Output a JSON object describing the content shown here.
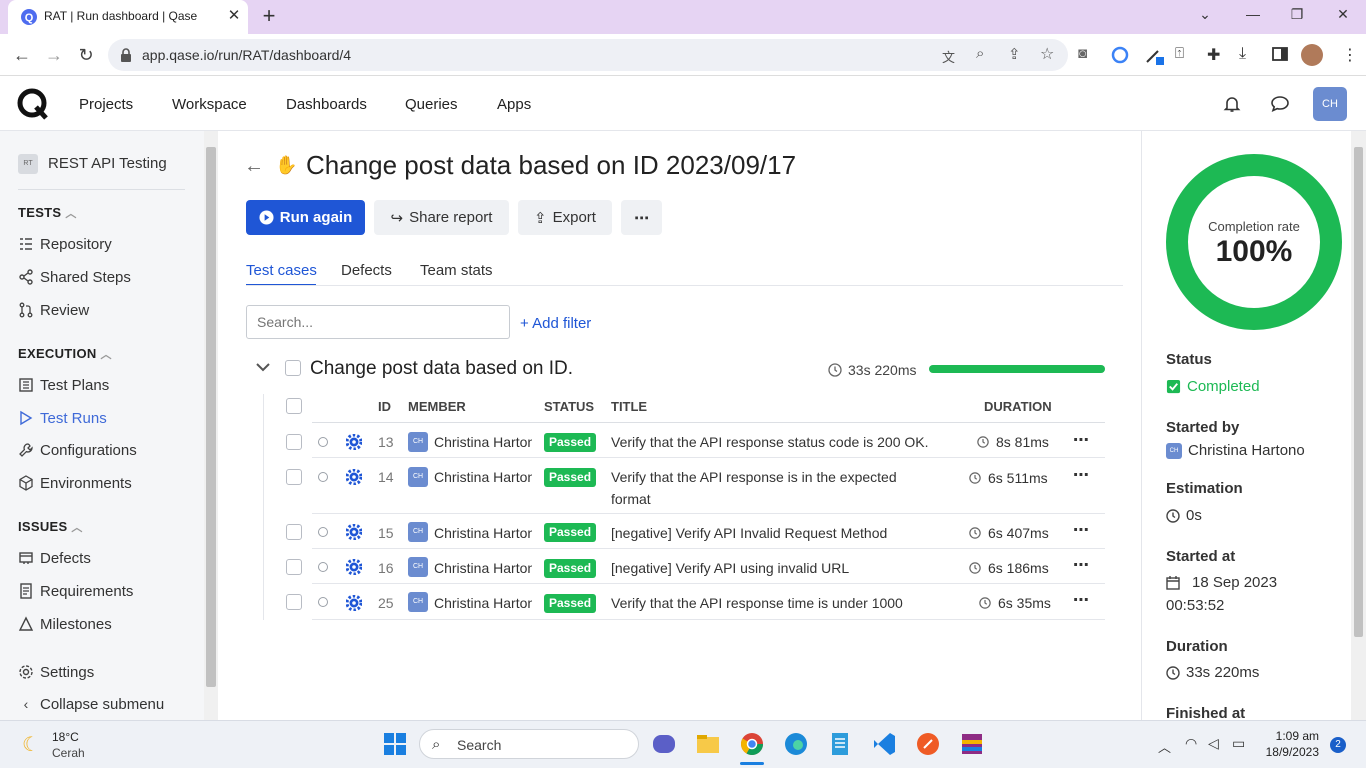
{
  "browser": {
    "tab_title": "RAT | Run dashboard | Qase",
    "url": "app.qase.io/run/RAT/dashboard/4",
    "accent": "#e6d4f3"
  },
  "appnav": {
    "links": [
      "Projects",
      "Workspace",
      "Dashboards",
      "Queries",
      "Apps"
    ],
    "avatar": "CH"
  },
  "sidebar": {
    "project_badge": "RT",
    "project": "REST API Testing",
    "tests_header": "TESTS",
    "tests": [
      "Repository",
      "Shared Steps",
      "Review"
    ],
    "execution_header": "EXECUTION",
    "execution": [
      "Test Plans",
      "Test Runs",
      "Configurations",
      "Environments"
    ],
    "issues_header": "ISSUES",
    "issues": [
      "Defects",
      "Requirements",
      "Milestones"
    ],
    "settings": "Settings",
    "collapse": "Collapse submenu"
  },
  "run": {
    "title": "Change post data based on ID 2023/09/17",
    "run_again": "Run again",
    "share_report": "Share report",
    "export": "Export",
    "more": "⋯",
    "tabs": [
      "Test cases",
      "Defects",
      "Team stats"
    ],
    "search_placeholder": "Search...",
    "add_filter": "+ Add filter"
  },
  "suite": {
    "name": "Change post data based on ID.",
    "duration": "33s 220ms",
    "progress": 1.0,
    "columns": {
      "id": "ID",
      "member": "MEMBER",
      "status": "STATUS",
      "title": "TITLE",
      "duration": "DURATION"
    },
    "rows": [
      {
        "id": "13",
        "member_initials": "CH",
        "member": "Christina Hartono",
        "status": "Passed",
        "title": "Verify that the API response status code is 200 OK.",
        "title2": "",
        "duration": "8s 81ms"
      },
      {
        "id": "14",
        "member_initials": "CH",
        "member": "Christina Hartono",
        "status": "Passed",
        "title": "Verify that the API response is in the expected",
        "title2": "format",
        "duration": "6s 511ms"
      },
      {
        "id": "15",
        "member_initials": "CH",
        "member": "Christina Hartono",
        "status": "Passed",
        "title": "[negative] Verify API Invalid Request Method",
        "title2": "",
        "duration": "6s 407ms"
      },
      {
        "id": "16",
        "member_initials": "CH",
        "member": "Christina Hartono",
        "status": "Passed",
        "title": "[negative] Verify API using invalid URL",
        "title2": "",
        "duration": "6s 186ms"
      },
      {
        "id": "25",
        "member_initials": "CH",
        "member": "Christina Hartono",
        "status": "Passed",
        "title": "Verify that the API response time is under 1000",
        "title2": "",
        "duration": "6s 35ms"
      }
    ]
  },
  "panel": {
    "completion_label": "Completion rate",
    "completion_value": "100%",
    "completion_fraction": 1.0,
    "status_label": "Status",
    "status_value": "Completed",
    "started_by_label": "Started by",
    "started_by_initials": "CH",
    "started_by_value": "Christina Hartono",
    "estimation_label": "Estimation",
    "estimation_value": "0s",
    "started_at_label": "Started at",
    "started_at_value": "18 Sep 2023",
    "started_at_time": "00:53:52",
    "duration_label": "Duration",
    "duration_value": "33s 220ms",
    "finished_label": "Finished at"
  },
  "taskbar": {
    "weather_temp": "18°C",
    "weather_desc": "Cerah",
    "search": "Search",
    "time": "1:09 am",
    "date": "18/9/2023",
    "notifications": "2"
  }
}
